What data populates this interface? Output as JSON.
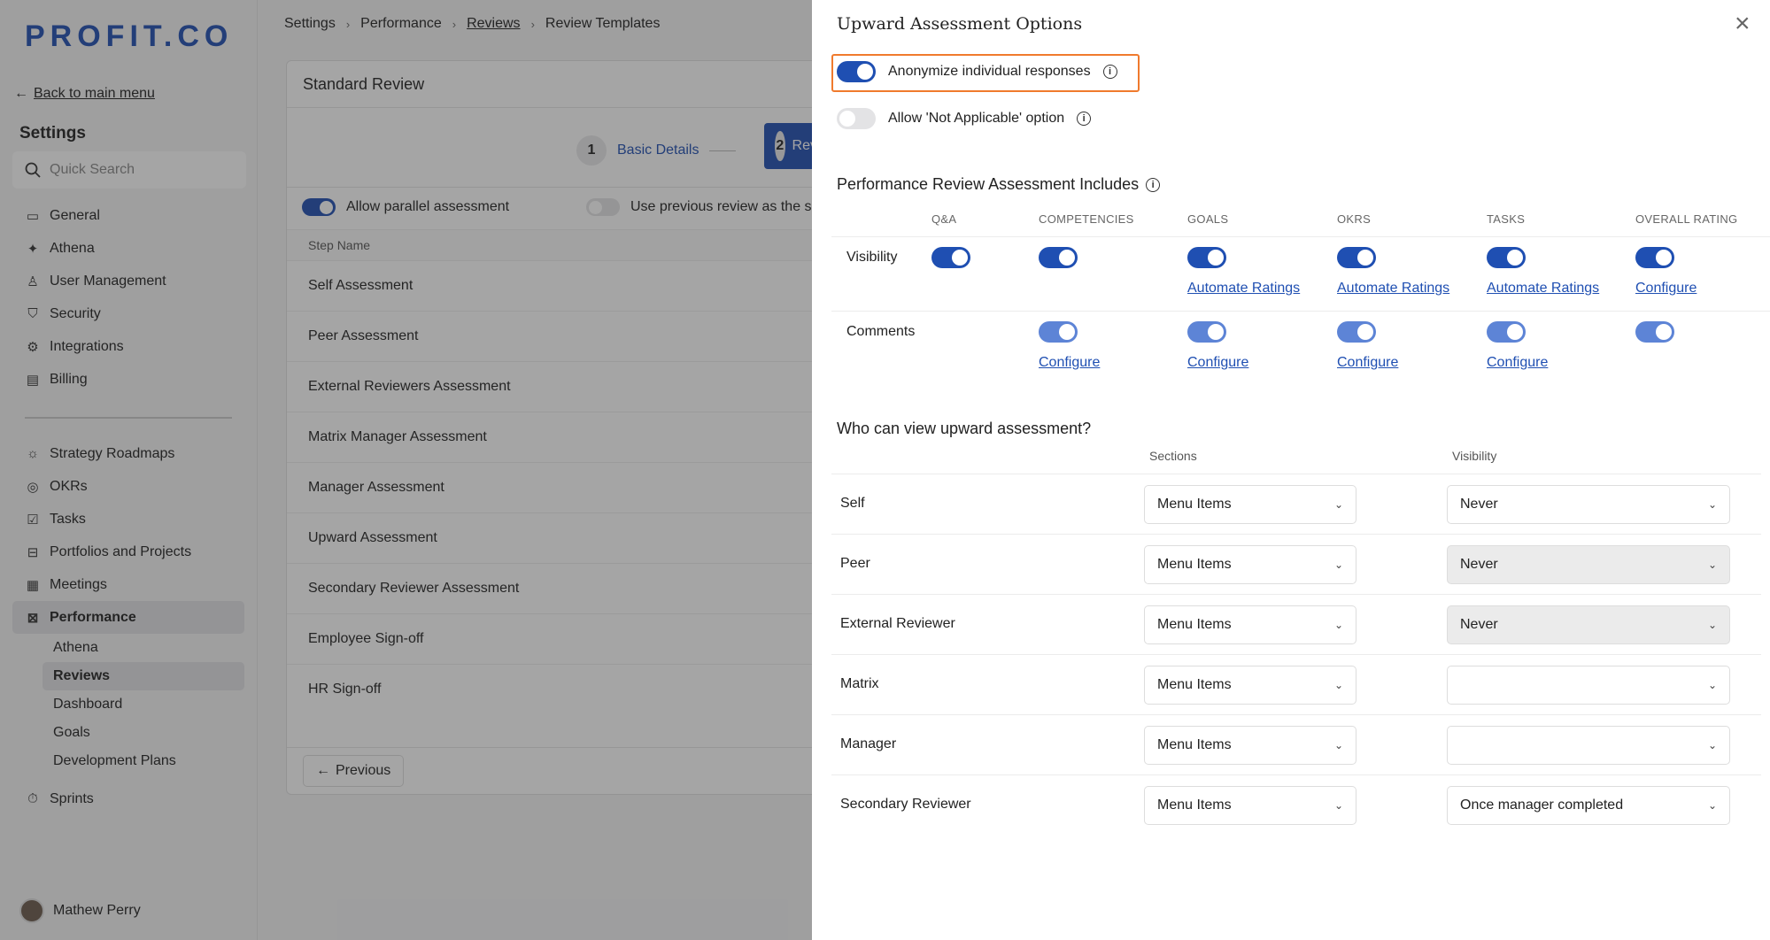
{
  "sidebar": {
    "logo": "PROFIT.CO",
    "back_label": "Back to main menu",
    "title": "Settings",
    "search_placeholder": "Quick Search",
    "items": [
      {
        "label": "General",
        "icon": "monitor-icon"
      },
      {
        "label": "Athena",
        "icon": "sparkle-icon"
      },
      {
        "label": "User Management",
        "icon": "user-icon"
      },
      {
        "label": "Security",
        "icon": "shield-icon"
      },
      {
        "label": "Integrations",
        "icon": "gear-icon"
      },
      {
        "label": "Billing",
        "icon": "receipt-icon"
      }
    ],
    "items2": [
      {
        "label": "Strategy Roadmaps",
        "icon": "bulb-icon"
      },
      {
        "label": "OKRs",
        "icon": "target-icon"
      },
      {
        "label": "Tasks",
        "icon": "task-icon"
      },
      {
        "label": "Portfolios and Projects",
        "icon": "briefcase-icon"
      },
      {
        "label": "Meetings",
        "icon": "calendar-icon"
      },
      {
        "label": "Performance",
        "icon": "chart-icon"
      }
    ],
    "perf_sub": [
      "Athena",
      "Reviews",
      "Dashboard",
      "Goals",
      "Development Plans"
    ],
    "sprints": "Sprints",
    "user_name": "Mathew Perry"
  },
  "breadcrumb": [
    "Settings",
    "Performance",
    "Reviews",
    "Review Templates"
  ],
  "card": {
    "title": "Standard Review",
    "step1_num": "1",
    "step1_label": "Basic Details",
    "step2_num": "2",
    "step2_label": "Rev",
    "opt_parallel": "Allow parallel assessment",
    "opt_previous": "Use previous review as the s",
    "steps_header": "Step Name",
    "steps": [
      "Self Assessment",
      "Peer Assessment",
      "External Reviewers Assessment",
      "Matrix Manager Assessment",
      "Manager Assessment",
      "Upward Assessment",
      "Secondary Reviewer Assessment",
      "Employee Sign-off",
      "HR Sign-off"
    ],
    "previous_label": "Previous"
  },
  "drawer": {
    "title": "Upward Assessment Options",
    "anonymize_label": "Anonymize individual responses",
    "anonymize_on": true,
    "not_applicable_label": "Allow 'Not Applicable' option",
    "not_applicable_on": false,
    "includes_title": "Performance Review Assessment Includes",
    "columns": [
      "Q&A",
      "COMPETENCIES",
      "GOALS",
      "OKRS",
      "TASKS",
      "OVERALL RATING"
    ],
    "visibility_label": "Visibility",
    "visibility_links": [
      "",
      "",
      "Automate Ratings",
      "Automate Ratings",
      "Automate Ratings",
      "Configure"
    ],
    "comments_label": "Comments",
    "comments_links": [
      "",
      "Configure",
      "Configure",
      "Configure",
      "Configure",
      ""
    ],
    "who_title": "Who can view upward assessment?",
    "sections_header": "Sections",
    "visibility_header": "Visibility",
    "viewers": [
      {
        "label": "Self",
        "section": "Menu Items",
        "visibility": "Never"
      },
      {
        "label": "Peer",
        "section": "Menu Items",
        "visibility": "Never"
      },
      {
        "label": "External Reviewer",
        "section": "Menu Items",
        "visibility": "Never"
      },
      {
        "label": "Matrix",
        "section": "Menu Items",
        "visibility": ""
      },
      {
        "label": "Manager",
        "section": "Menu Items",
        "visibility": ""
      },
      {
        "label": "Secondary Reviewer",
        "section": "Menu Items",
        "visibility": "Once manager completed"
      }
    ]
  },
  "colors": {
    "accent": "#1f4fb2",
    "highlight": "#f07a2d"
  }
}
